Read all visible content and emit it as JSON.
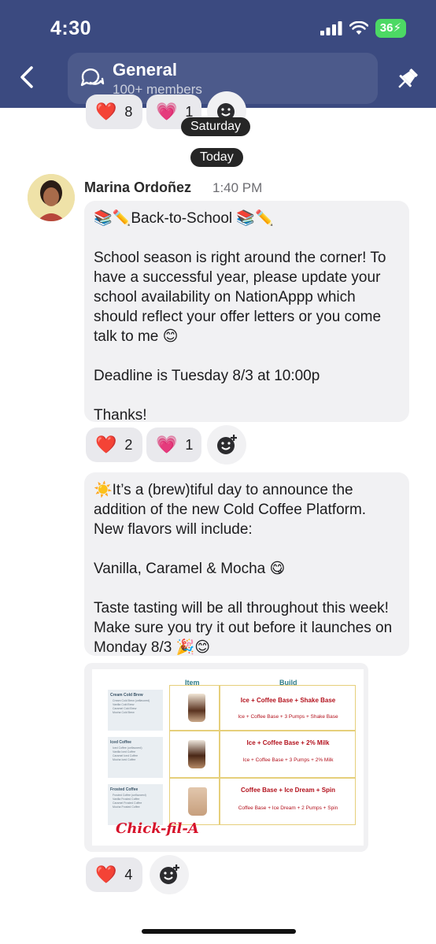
{
  "status_bar": {
    "time": "4:30",
    "battery": "36"
  },
  "header": {
    "title": "General",
    "subtitle": "100+ members",
    "icons": [
      "back-chevron-icon",
      "chat-bubble-icon",
      "pin-icon"
    ]
  },
  "top_partial": {
    "reactions": [
      {
        "emoji": "❤️",
        "count": "8"
      },
      {
        "emoji": "💗",
        "count": "1"
      }
    ],
    "date_label": "Saturday"
  },
  "today_label": "Today",
  "message": {
    "sender": "Marina Ordoñez",
    "time": "1:40 PM",
    "posts": [
      {
        "lines": [
          "📚✏️Back-to-School 📚✏️",
          "",
          "School season is right around the corner! To have a successful year, please update your school availability on NationAppp which should reflect your offer letters or you come talk to me 😊",
          "",
          "Deadline is Tuesday 8/3 at 10:00p",
          "",
          "Thanks!"
        ],
        "reactions": [
          {
            "emoji": "❤️",
            "count": "2"
          },
          {
            "emoji": "💗",
            "count": "1"
          }
        ]
      },
      {
        "lines": [
          "☀️It’s a (brew)tiful day to announce the addition of the new Cold Coffee Platform. New flavors will include:",
          "",
          "Vanilla, Caramel & Mocha 😋",
          "",
          "Taste tasting will be all throughout this week! Make sure you try it out before it launches on Monday 8/3 🎉😊"
        ]
      }
    ],
    "attachment": {
      "headers": {
        "item": "Item",
        "build": "Build"
      },
      "logo": "Chick-fil-A",
      "rows": [
        {
          "menu_title": "Cream Cold Brew",
          "menu_items": [
            "Cream Cold Brew (unflavored)",
            "Vanilla Cold Brew",
            "Caramel Cold Brew",
            "Mocha Cold Brew"
          ],
          "build_main": "Ice + Coffee Base + Shake Base",
          "build_sub": "Ice + Coffee Base + 3 Pumps + Shake Base"
        },
        {
          "menu_title": "Iced Coffee",
          "menu_items": [
            "Iced Coffee (unflavored)",
            "Vanilla Iced Coffee",
            "Caramel Iced Coffee",
            "Mocha Iced Coffee"
          ],
          "build_main": "Ice + Coffee Base + 2% Milk",
          "build_sub": "Ice + Coffee Base + 3 Pumps + 2% Milk"
        },
        {
          "menu_title": "Frosted Coffee",
          "menu_items": [
            "Frosted Coffee (unflavored)",
            "Vanilla Frosted Coffee",
            "Caramel Frosted Coffee",
            "Mocha Frosted Coffee"
          ],
          "build_main": "Coffee Base + Ice Dream + Spin",
          "build_sub": "Coffee Base + Ice Dream + 2 Pumps + Spin"
        }
      ]
    },
    "attachment_reactions": [
      {
        "emoji": "❤️",
        "count": "4"
      }
    ]
  },
  "colors": {
    "header_bg": "#3b4a80",
    "bubble_bg": "#f1f1f3",
    "reaction_bg": "#e9e9ed",
    "battery": "#4cd964",
    "build_text": "#b3121d"
  }
}
